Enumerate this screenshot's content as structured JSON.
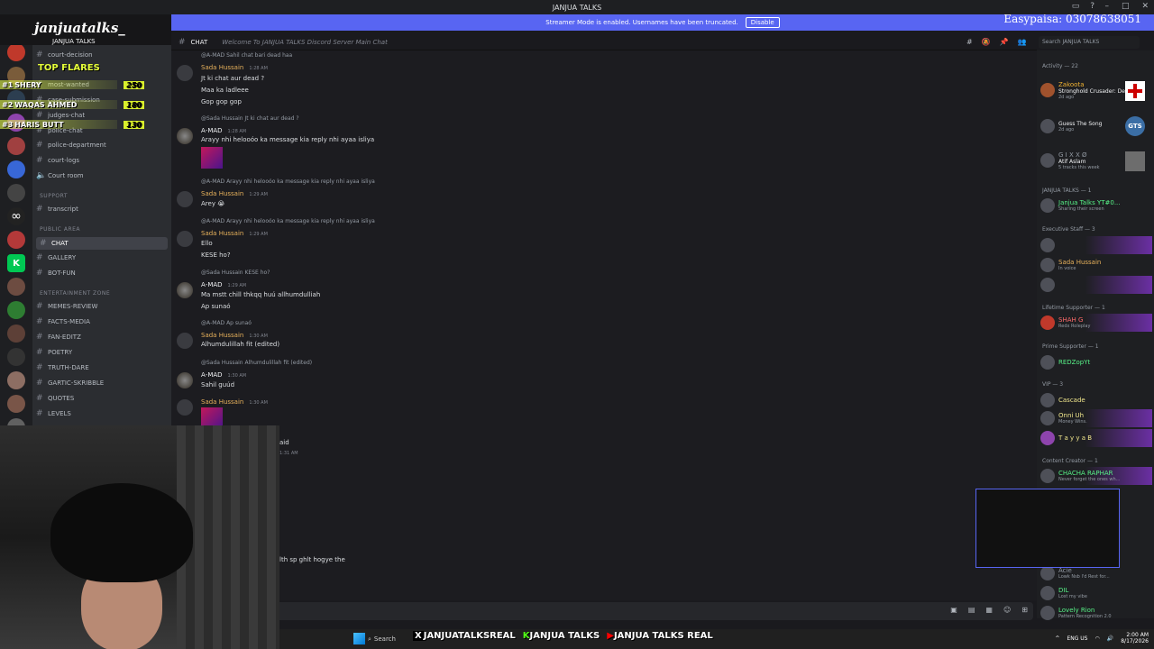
{
  "window": {
    "title": "JANJUA TALKS"
  },
  "banner": {
    "text": "Streamer Mode is enabled. Usernames have been truncated.",
    "button": "Disable"
  },
  "overlay": {
    "easypaisa": "Easypaisa: 03078638051",
    "logo": "janjuatalks_",
    "flares_title": "TOP FLARES",
    "ranks": [
      {
        "pos": "#1",
        "name": "SHERY",
        "pts": "250"
      },
      {
        "pos": "#2",
        "name": "WAQAS AHMED",
        "pts": "180"
      },
      {
        "pos": "#3",
        "name": "HARIS BUTT",
        "pts": "130"
      }
    ]
  },
  "server": {
    "name": "JANJUA TALKS"
  },
  "channels": [
    {
      "label": "court-decision"
    },
    {
      "label": "most-wanted"
    },
    {
      "label": "case-submission"
    },
    {
      "label": "judges-chat"
    },
    {
      "label": "police-chat"
    },
    {
      "label": "police-department"
    },
    {
      "label": "court-logs"
    },
    {
      "label": "Court room"
    },
    {
      "label": "transcript"
    },
    {
      "label": "CHAT"
    },
    {
      "label": "GALLERY"
    },
    {
      "label": "BOT-FUN"
    },
    {
      "label": "MEMES-REVIEW"
    },
    {
      "label": "FACTS-MEDIA"
    },
    {
      "label": "FAN-EDITZ"
    },
    {
      "label": "POETRY"
    },
    {
      "label": "TRUTH-DARE"
    },
    {
      "label": "GARTIC-SKRIBBLE"
    },
    {
      "label": "QUOTES"
    },
    {
      "label": "LEVELS"
    }
  ],
  "categories": {
    "support": "SUPPORT",
    "public": "PUBLIC AREA",
    "entertainment": "ENTERTAINMENT ZONE"
  },
  "chatbar": {
    "channel": "CHAT",
    "topic": "Welcome To JANJUA TALKS Discord Server Main Chat",
    "search": "Search JANJUA TALKS"
  },
  "messages": [
    {
      "reply": "@A‑MAD  Sahil chat bari dead haa",
      "author": "Sada Hussain",
      "time": "1:28 AM",
      "lines": [
        "Jt ki chat aur dead ?",
        "Maa ka ladleee",
        "Gop gop gop"
      ]
    },
    {
      "reply": "@Sada Hussain  Jt ki chat aur dead ?",
      "author": "A‑MAD",
      "time": "1:28 AM",
      "lines": [
        "Arayy nhi helooóo ka message kia reply nhi ayaa isliya"
      ]
    },
    {
      "reply": "@A‑MAD  Arayy nhi helooóo ka message kia reply nhi ayaa isliya",
      "author": "Sada Hussain",
      "time": "1:29 AM",
      "lines": [
        "Arey 😭"
      ]
    },
    {
      "reply": "@A‑MAD  Arayy nhi helooóo ka message kia reply nhi ayaa isliya",
      "author": "Sada Hussain",
      "time": "1:29 AM",
      "lines": [
        "Ello",
        "KESE ho?"
      ]
    },
    {
      "reply": "@Sada Hussain  KESE ho?",
      "author": "A‑MAD",
      "time": "1:29 AM",
      "lines": [
        "Ma mstt chill thkqq huú allhumdulliah",
        "Ap sunaó"
      ]
    },
    {
      "reply": "@A‑MAD  Ap sunaó",
      "author": "Sada Hussain",
      "time": "1:30 AM",
      "lines": [
        "Alhumdulillah fit (edited)"
      ]
    },
    {
      "reply": "@Sada Hussain  Alhumdulillah fit (edited)",
      "author": "A‑MAD",
      "time": "1:30 AM",
      "lines": [
        "Sahil guúd"
      ]
    },
    {
      "reply": "",
      "author": "Sada Hussain",
      "time": "1:30 AM",
      "lines": []
    },
    {
      "reply": "",
      "author": "",
      "time": "",
      "lines": [
        "aid",
        "1:31 AM",
        "lth sp ghlt hogye the"
      ]
    }
  ],
  "members": {
    "activity_title": "Activity — 22",
    "activity": [
      {
        "name": "Zakoota",
        "status": "Stronghold Crusader: Defi...",
        "time": "2d ago"
      },
      {
        "name": "",
        "status": "Guess The Song",
        "time": "2d ago"
      },
      {
        "name": "G I X X Ø",
        "status": "Atif Aslam",
        "time": "5 tracks this week"
      }
    ],
    "groups": [
      {
        "title": "JANJUA TALKS — 1",
        "items": [
          {
            "name": "Janjua Talks YT#0...",
            "sub": "Sharing their screen"
          }
        ]
      },
      {
        "title": "Executive Staff — 3",
        "items": [
          {
            "name": "",
            "sub": ""
          },
          {
            "name": "Sada Hussain",
            "sub": "In voice"
          },
          {
            "name": "",
            "sub": ""
          }
        ]
      },
      {
        "title": "Lifetime Supporter — 1",
        "items": [
          {
            "name": "SHAH G",
            "sub": "Redx Roleplay"
          }
        ]
      },
      {
        "title": "Prime Supporter — 1",
        "items": [
          {
            "name": "REDZopYt",
            "sub": ""
          }
        ]
      },
      {
        "title": "VIP — 3",
        "items": [
          {
            "name": "Cascade",
            "sub": ""
          },
          {
            "name": "Onni Uh",
            "sub": "Money Wins."
          },
          {
            "name": "T a y y a B",
            "sub": ""
          }
        ]
      },
      {
        "title": "Content Creator — 1",
        "items": [
          {
            "name": "CHACHA RAPHAR",
            "sub": "Never forget the ones wh..."
          }
        ]
      }
    ],
    "bottom": [
      {
        "name": "Acie",
        "sub": "Lowk Nsb I'd Rest for..."
      },
      {
        "name": "DIL",
        "sub": "Lost my vibe"
      },
      {
        "name": "Lovely Rion",
        "sub": "Pattern Recognition 2.0"
      }
    ]
  },
  "taskbar": {
    "search": "Search",
    "socials": [
      "JANJUATALKSREAL",
      "JANJUA TALKS",
      "JANJUA TALKS REAL"
    ],
    "lang": "ENG US",
    "time": "2:00 AM",
    "date": "8/17/2026"
  }
}
